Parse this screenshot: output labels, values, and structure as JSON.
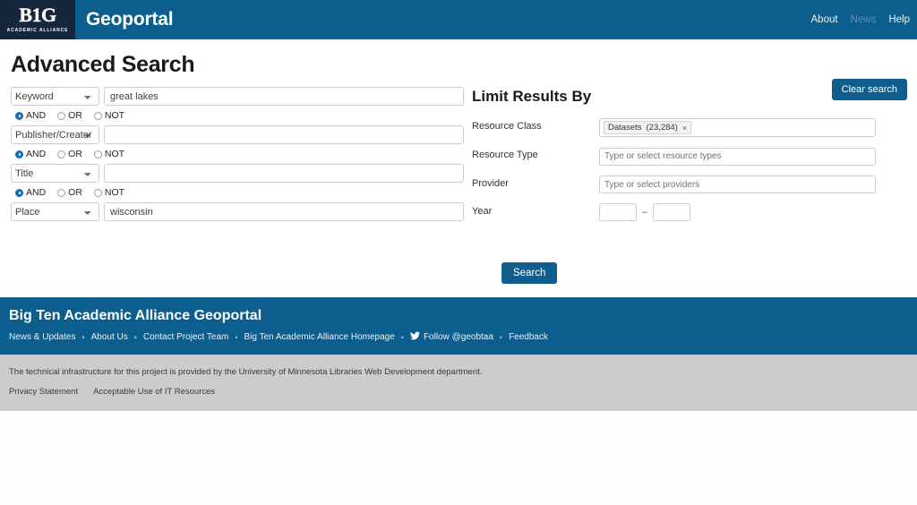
{
  "header": {
    "logo_mark": "B1G",
    "logo_sub": "ACADEMIC ALLIANCE",
    "brand": "Geoportal",
    "nav": [
      {
        "label": "About",
        "muted": false
      },
      {
        "label": "News",
        "muted": true
      },
      {
        "label": "Help",
        "muted": false
      }
    ]
  },
  "main": {
    "title": "Advanced Search",
    "clear_label": "Clear search",
    "search_rows": [
      {
        "field": "Keyword",
        "value": "great lakes"
      },
      {
        "field": "Publisher/Creator",
        "value": ""
      },
      {
        "field": "Title",
        "value": ""
      },
      {
        "field": "Place",
        "value": "wisconsin"
      }
    ],
    "boolean_options": [
      "AND",
      "OR",
      "NOT"
    ],
    "boolean_selected": "AND"
  },
  "limit": {
    "title": "Limit Results By",
    "resource_class": {
      "label": "Resource Class",
      "token_label": "Datasets",
      "token_count": "(23,284)",
      "token_remove": "×"
    },
    "resource_type": {
      "label": "Resource Type",
      "placeholder": "Type or select resource types",
      "value": ""
    },
    "provider": {
      "label": "Provider",
      "placeholder": "Type or select providers",
      "value": ""
    },
    "year": {
      "label": "Year",
      "from": "",
      "to": "",
      "separator": "–"
    },
    "search_label": "Search"
  },
  "footer": {
    "title": "Big Ten Academic Alliance Geoportal",
    "links": [
      "News & Updates",
      "About Us",
      "Contact Project Team",
      "Big Ten Academic Alliance Homepage"
    ],
    "twitter_label": "Follow @geobtaa",
    "feedback_label": "Feedback",
    "separator": "•",
    "notice": "The technical infrastructure for this project is provided by the University of Minnesota Libraries Web Development department.",
    "legal": [
      "Privacy Statement",
      "Acceptable Use of IT Resources"
    ],
    "legal_separator": "·"
  },
  "colors": {
    "brand_blue": "#0c5e8e",
    "logo_navy": "#15263d",
    "button_blue": "#0f5d8c",
    "footer_grey": "#cccccc",
    "radio_blue": "#1070c0"
  }
}
